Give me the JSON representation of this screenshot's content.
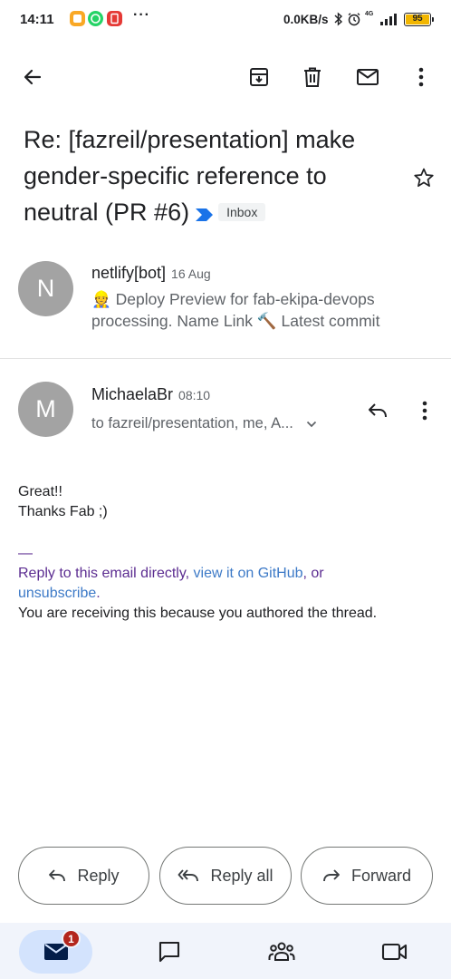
{
  "status_bar": {
    "time": "14:11",
    "more": "···",
    "net_speed": "0.0KB/s",
    "network_type": "4G",
    "battery": "95"
  },
  "app_bar": {
    "icons": [
      "back-arrow-icon",
      "archive-icon",
      "delete-icon",
      "mark-unread-icon",
      "more-vert-icon"
    ]
  },
  "thread": {
    "subject": "Re: [fazreil/presentation] make gender-specific reference to neutral (PR #6)",
    "label": "Inbox",
    "important_color": "#1a73e8"
  },
  "messages": [
    {
      "avatar_letter": "N",
      "sender": "netlify[bot]",
      "time": "16 Aug",
      "snippet_line1": "👷 Deploy Preview for fab-ekipa-devops",
      "snippet_line2": "processing. Name Link 🔨 Latest commit"
    },
    {
      "avatar_letter": "M",
      "sender": "MichaelaBr",
      "time": "08:10",
      "recipients": "to fazreil/presentation, me, A...",
      "body": {
        "line1": "Great!!",
        "line2": "Thanks Fab ;)",
        "separator": "—",
        "reply_text": "Reply to this email directly, ",
        "view_link": "view it on GitHub",
        "or_text": ", or",
        "unsubscribe": "unsubscribe",
        "period": ".",
        "footer": "You are receiving this because you authored the thread."
      }
    }
  ],
  "actions": {
    "reply": "Reply",
    "reply_all": "Reply all",
    "forward": "Forward"
  },
  "bottom_nav": {
    "mail_badge": "1",
    "items": [
      "mail-icon",
      "chat-icon",
      "spaces-icon",
      "meet-icon"
    ]
  }
}
